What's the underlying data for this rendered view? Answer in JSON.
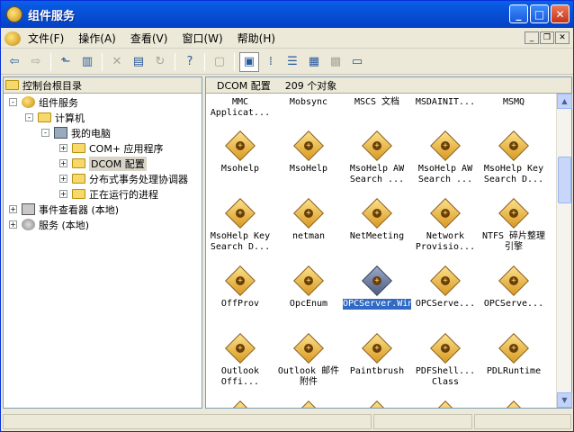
{
  "window": {
    "title": "组件服务"
  },
  "menu": [
    "文件(F)",
    "操作(A)",
    "查看(V)",
    "窗口(W)",
    "帮助(H)"
  ],
  "left_pane": {
    "header": "控制台根目录",
    "tree": [
      {
        "label": "组件服务",
        "level": 1,
        "expander": "-"
      },
      {
        "label": "计算机",
        "level": 2,
        "expander": "-"
      },
      {
        "label": "我的电脑",
        "level": 3,
        "expander": "-"
      },
      {
        "label": "COM+ 应用程序",
        "level": 4,
        "expander": "+"
      },
      {
        "label": "DCOM 配置",
        "level": 4,
        "expander": "+",
        "selected": true
      },
      {
        "label": "分布式事务处理协调器",
        "level": 4,
        "expander": "+"
      },
      {
        "label": "正在运行的进程",
        "level": 4,
        "expander": "+"
      },
      {
        "label": "事件查看器 (本地)",
        "level": 0,
        "expander": "+"
      },
      {
        "label": "服务 (本地)",
        "level": 0,
        "expander": "+"
      }
    ]
  },
  "right_pane": {
    "header_title": "DCOM 配置",
    "header_count": "209 个对象",
    "top_row": [
      "MMC Applicat...",
      "Mobsync",
      "MSCS 文档",
      "MSDAINIT...",
      "MSMQ"
    ],
    "items": [
      "Msohelp",
      "MsoHelp",
      "MsoHelp AW Search ...",
      "MsoHelp AW Search ...",
      "MsoHelp Key Search D...",
      "MsoHelp Key Search D...",
      "netman",
      "NetMeeting",
      "Network Provisio...",
      "NTFS 碎片整理引擎",
      "OffProv",
      "OpcEnum",
      "OPCServer.WinCC",
      "OPCServe...",
      "OPCServe...",
      "Outlook Offi...",
      "Outlook 邮件附件",
      "Paintbrush",
      "PDFShell... Class",
      "PDLRuntime"
    ],
    "selected_item": "OPCServer.WinCC"
  }
}
